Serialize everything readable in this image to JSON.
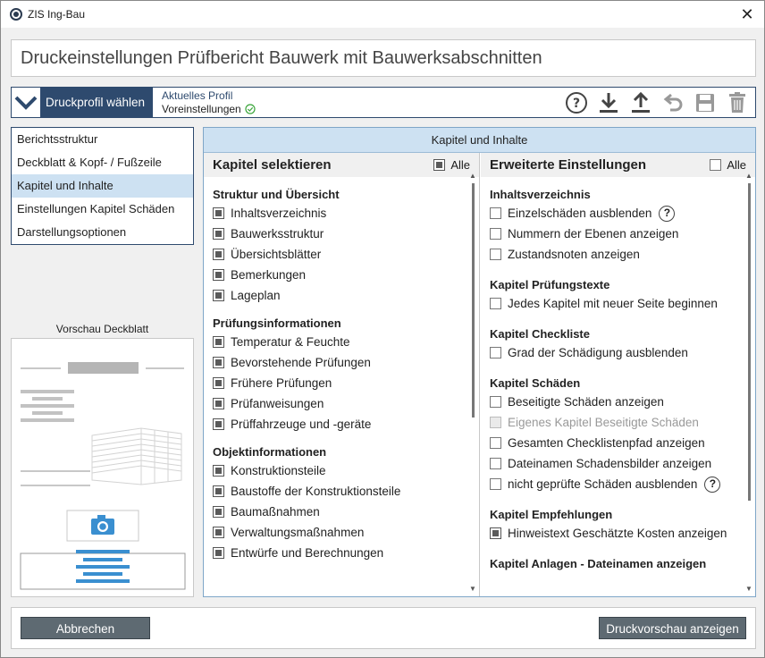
{
  "window": {
    "title": "ZIS Ing-Bau"
  },
  "header": {
    "title": "Druckeinstellungen Prüfbericht Bauwerk mit Bauwerksabschnitten"
  },
  "profile": {
    "button_label": "Druckprofil wählen",
    "current_label": "Aktuelles Profil",
    "current_value": "Voreinstellungen"
  },
  "nav": {
    "items": [
      "Berichtsstruktur",
      "Deckblatt & Kopf- / Fußzeile",
      "Kapitel und Inhalte",
      "Einstellungen Kapitel Schäden",
      "Darstellungsoptionen"
    ],
    "active_index": 2
  },
  "preview": {
    "label": "Vorschau Deckblatt"
  },
  "main": {
    "header": "Kapitel und Inhalte",
    "left": {
      "title": "Kapitel selektieren",
      "all_label": "Alle",
      "sections": [
        {
          "title": "Struktur und Übersicht",
          "items": [
            "Inhaltsverzeichnis",
            "Bauwerksstruktur",
            "Übersichtsblätter",
            "Bemerkungen",
            "Lageplan"
          ]
        },
        {
          "title": "Prüfungsinformationen",
          "items": [
            "Temperatur & Feuchte",
            "Bevorstehende Prüfungen",
            "Frühere Prüfungen",
            "Prüfanweisungen",
            "Prüffahrzeuge und -geräte"
          ]
        },
        {
          "title": "Objektinformationen",
          "items": [
            "Konstruktionsteile",
            "Baustoffe der Konstruktionsteile",
            "Baumaßnahmen",
            "Verwaltungsmaßnahmen",
            "Entwürfe und Berechnungen"
          ]
        }
      ]
    },
    "right": {
      "title": "Erweiterte Einstellungen",
      "all_label": "Alle",
      "sections": [
        {
          "title": "Inhaltsverzeichnis",
          "items": [
            "Einzelschäden ausblenden",
            "Nummern der Ebenen anzeigen",
            "Zustandsnoten anzeigen"
          ]
        },
        {
          "title": "Kapitel Prüfungstexte",
          "items": [
            "Jedes Kapitel mit neuer Seite beginnen"
          ]
        },
        {
          "title": "Kapitel Checkliste",
          "items": [
            "Grad der Schädigung ausblenden"
          ]
        },
        {
          "title": "Kapitel Schäden",
          "items": [
            "Beseitigte Schäden anzeigen",
            "Eigenes Kapitel Beseitigte Schäden",
            "Gesamten Checklistenpfad anzeigen",
            "Dateinamen Schadensbilder anzeigen",
            "nicht geprüfte Schäden ausblenden"
          ]
        },
        {
          "title": "Kapitel Empfehlungen",
          "items": [
            "Hinweistext Geschätzte Kosten anzeigen"
          ]
        },
        {
          "title": "Kapitel Anlagen - Dateinamen anzeigen",
          "items": []
        }
      ]
    }
  },
  "footer": {
    "cancel_label": "Abbrechen",
    "preview_label": "Druckvorschau anzeigen"
  },
  "icons": [
    "help-icon",
    "download-icon",
    "upload-icon",
    "undo-icon",
    "save-icon",
    "trash-icon"
  ],
  "colors": {
    "accent": "#2e4a6e",
    "highlight": "#cde1f2",
    "button": "#5e6a72",
    "ok": "#3aa53a"
  }
}
